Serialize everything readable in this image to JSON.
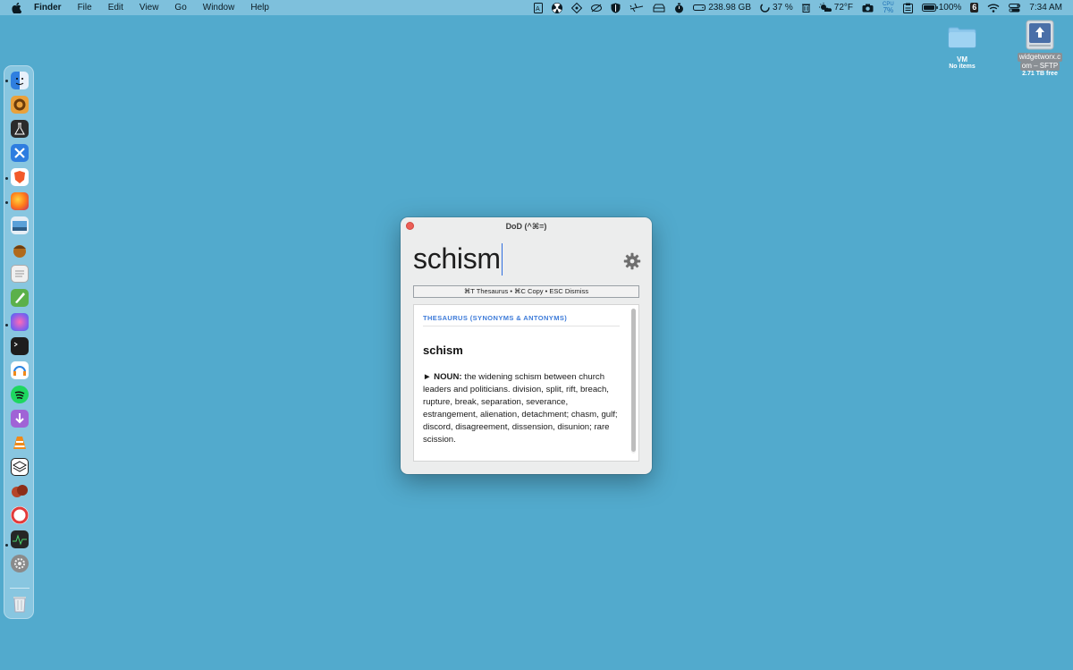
{
  "menubar": {
    "app_name": "Finder",
    "menus": [
      "File",
      "Edit",
      "View",
      "Go",
      "Window",
      "Help"
    ],
    "status": {
      "disk_free": "238.98 GB",
      "memory_pct": "37 %",
      "weather": "72°F",
      "cpu_label": "CPU",
      "cpu_pct": "7%",
      "battery_pct": "100%",
      "badge_count": "6",
      "clock": "7:34 AM"
    }
  },
  "desktop": {
    "vm_folder": {
      "label": "VM",
      "sub": "No items"
    },
    "sftp_drive": {
      "label_line1": "widgetworx.c",
      "label_line2": "om – SFTP",
      "sub": "2.71 TB free"
    }
  },
  "dock": {
    "items": [
      {
        "name": "finder",
        "color": "#3f8fe0"
      },
      {
        "name": "app-orange-ring",
        "color": "#e9a13b"
      },
      {
        "name": "flask-app",
        "color": "#2b2b2b"
      },
      {
        "name": "xcode-tools",
        "color": "#2e7de0"
      },
      {
        "name": "brave-browser",
        "color": "#f25a2a"
      },
      {
        "name": "firefox",
        "color": "#ff7b1a"
      },
      {
        "name": "preview-app",
        "color": "#5aa0d8"
      },
      {
        "name": "acorn-app",
        "color": "#b06a1c"
      },
      {
        "name": "textedit",
        "color": "#f0f0f0"
      },
      {
        "name": "pencil-app",
        "color": "#5bb04a"
      },
      {
        "name": "arc-browser",
        "color": "#8e5ee8"
      },
      {
        "name": "terminal",
        "color": "#1d1d1d"
      },
      {
        "name": "audio-app",
        "color": "#2d84e0"
      },
      {
        "name": "spotify",
        "color": "#1ed760"
      },
      {
        "name": "downloader",
        "color": "#a063d6"
      },
      {
        "name": "vlc",
        "color": "#f08a1a"
      },
      {
        "name": "layers-app",
        "color": "#1a1a1a"
      },
      {
        "name": "boxing-app",
        "color": "#b5452a"
      },
      {
        "name": "record-app",
        "color": "#e23b3b"
      },
      {
        "name": "activity-monitor",
        "color": "#262626"
      },
      {
        "name": "system-settings",
        "color": "#8a8a8a"
      },
      {
        "name": "trash",
        "color": "#d8dde0"
      }
    ]
  },
  "window": {
    "title": "DoD (^⌘=)",
    "query": "schism",
    "hint": "⌘T Thesaurus • ⌘C Copy • ESC Dismiss",
    "section_heading": "THESAURUS (SYNONYMS & ANTONYMS)",
    "entry_word": "schism",
    "pos_marker": "► NOUN:",
    "definition": " the widening schism between church leaders and politicians. division, split, rift, breach, rupture, break, separation, severance, estrangement, alienation, detachment; chasm, gulf; discord, disagreement, dissension, disunion; rare scission.",
    "scroll_position": 0
  },
  "colors": {
    "desktop": "#52aacd",
    "menubar": "#7ec0dc",
    "accent_blue": "#3d7bd9",
    "close_red": "#ec5f57"
  }
}
